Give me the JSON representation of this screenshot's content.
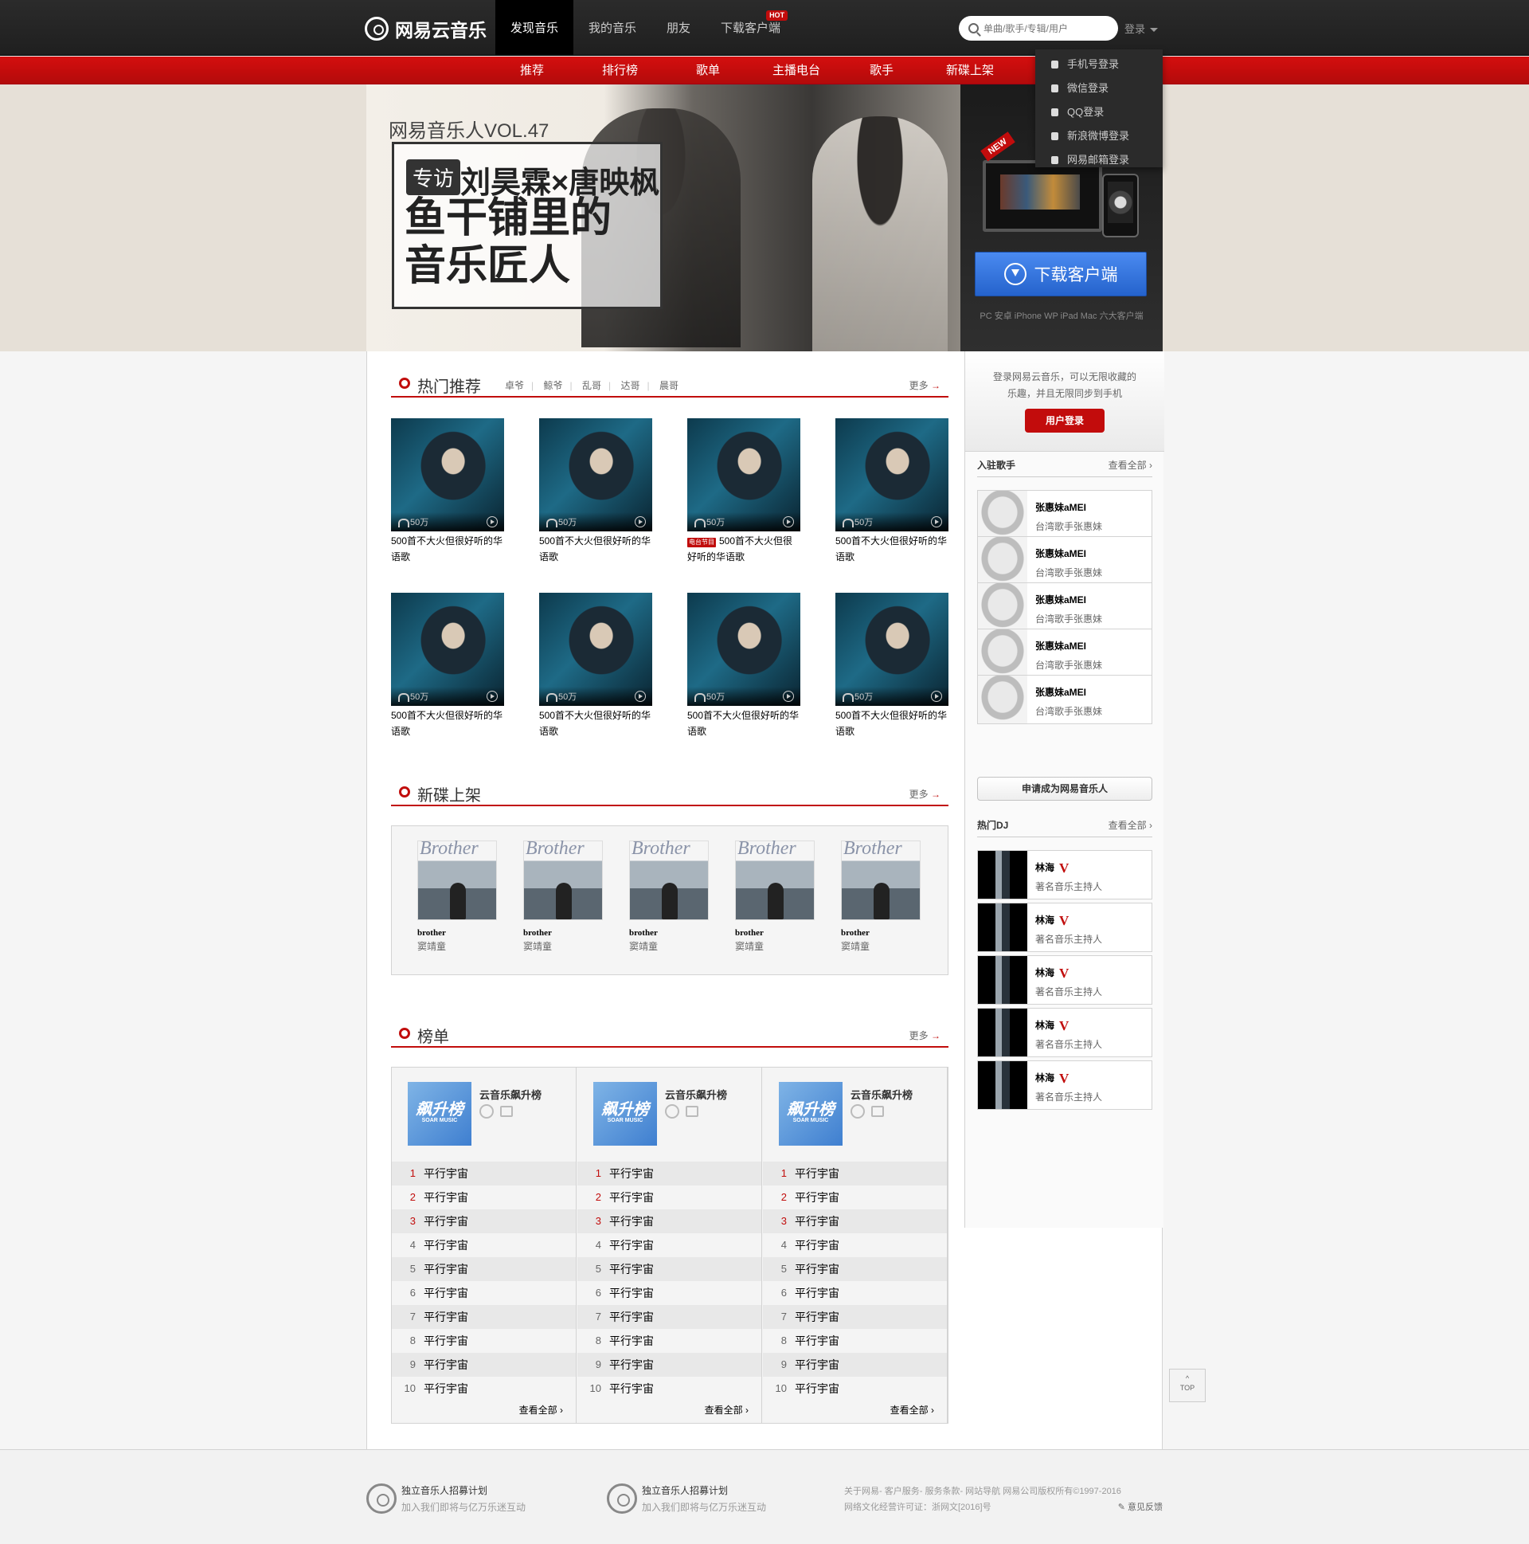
{
  "header": {
    "logo": "网易云音乐",
    "nav": [
      "发现音乐",
      "我的音乐",
      "朋友",
      "下载客户端"
    ],
    "hot_badge": "HOT",
    "search_placeholder": "单曲/歌手/专辑/用户",
    "login": "登录"
  },
  "login_menu": [
    "手机号登录",
    "微信登录",
    "QQ登录",
    "新浪微博登录",
    "网易邮箱登录"
  ],
  "subnav": [
    "推荐",
    "排行榜",
    "歌单",
    "主播电台",
    "歌手",
    "新碟上架"
  ],
  "banner": {
    "vol": "网易音乐人VOL.47",
    "tag": "专访",
    "title": "刘昊霖×唐映枫",
    "headline1": "鱼干铺里的",
    "headline2": "音乐匠人",
    "new": "NEW",
    "download_btn": "下载客户端",
    "platforms": "PC 安卓 iPhone WP iPad Mac 六大客户端"
  },
  "hot": {
    "title": "热门推荐",
    "tabs": [
      "卓爷",
      "鲸爷",
      "乱哥",
      "达哥",
      "晨哥"
    ],
    "more": "更多",
    "playcount": "50万",
    "radio_tag": "电台节目",
    "items": [
      {
        "title": "500首不大火但很好听的华语歌"
      },
      {
        "title": "500首不大火但很好听的华语歌"
      },
      {
        "title": "500首不大火但很好听的华语歌"
      },
      {
        "title": "500首不大火但很好听的华语歌"
      },
      {
        "title": "500首不大火但很好听的华语歌"
      },
      {
        "title": "500首不大火但很好听的华语歌"
      },
      {
        "title": "500首不大火但很好听的华语歌"
      },
      {
        "title": "500首不大火但很好听的华语歌"
      }
    ]
  },
  "albums": {
    "title": "新碟上架",
    "more": "更多",
    "cover_text": "Brother",
    "items": [
      {
        "name": "brother",
        "artist": "窦靖童"
      },
      {
        "name": "brother",
        "artist": "窦靖童"
      },
      {
        "name": "brother",
        "artist": "窦靖童"
      },
      {
        "name": "brother",
        "artist": "窦靖童"
      },
      {
        "name": "brother",
        "artist": "窦靖童"
      }
    ]
  },
  "charts": {
    "title": "榜单",
    "more": "更多",
    "cover_text": "飙升榜",
    "cover_sub": "SOAR MUSIC",
    "name": "云音乐飙升榜",
    "song": "平行宇宙",
    "view_all": "查看全部",
    "numbers": [
      "1",
      "2",
      "3",
      "4",
      "5",
      "6",
      "7",
      "8",
      "9",
      "10"
    ]
  },
  "sidebar": {
    "login_text": "登录网易云音乐，可以无限收藏的乐趣，并且无限同步到手机",
    "login_btn": "用户登录",
    "singers_title": "入驻歌手",
    "view_all": "查看全部",
    "singer_name": "张惠妹aMEI",
    "singer_desc": "台湾歌手张惠妹",
    "apply": "申请成为网易音乐人",
    "dj_title": "热门DJ",
    "dj_name": "林海",
    "dj_v": "V",
    "dj_desc": "著名音乐主持人"
  },
  "footer": {
    "promo_title": "独立音乐人招募计划",
    "promo_sub": "加入我们即将与亿万乐迷互动",
    "links": "关于网易- 客户服务- 服务条款- 网站导航  网易公司版权所有©1997-2016",
    "license": "网络文化经营许可证：浙网文[2016]号",
    "feedback": "意见反馈"
  },
  "back_to_top": "TOP",
  "colors": {
    "brand_red": "#c20c0c",
    "dark": "#242424",
    "blue_btn": "#2f6fdd"
  }
}
